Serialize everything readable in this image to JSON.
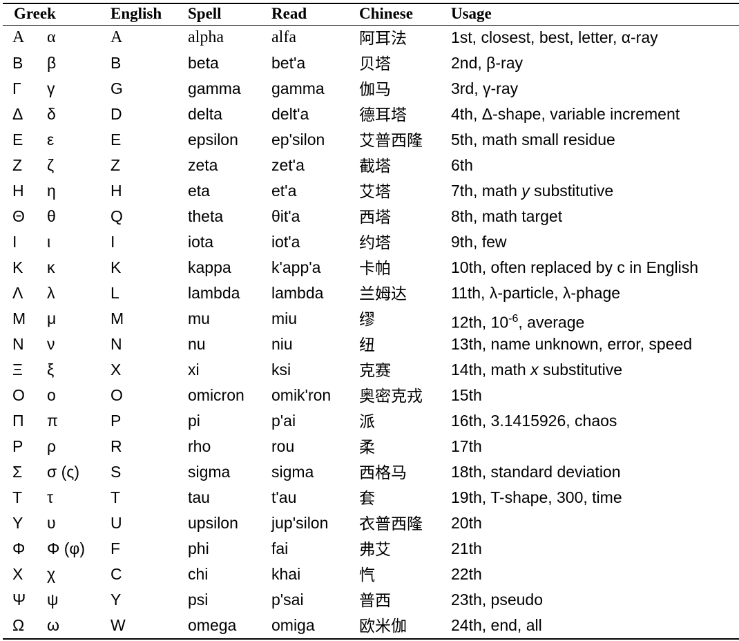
{
  "header": {
    "greek": "Greek",
    "english": "English",
    "spell": "Spell",
    "read": "Read",
    "chinese": "Chinese",
    "usage": "Usage"
  },
  "rows": [
    {
      "upper": "Α",
      "lower": "α",
      "english": "A",
      "spell": "alpha",
      "read": "alfa",
      "chinese": "阿耳法",
      "usage": "1st, closest, best, letter, α-ray"
    },
    {
      "upper": "Β",
      "lower": "β",
      "english": "B",
      "spell": "beta",
      "read": "bet'a",
      "chinese": "贝塔",
      "usage": "2nd, β-ray"
    },
    {
      "upper": "Γ",
      "lower": "γ",
      "english": "G",
      "spell": "gamma",
      "read": "gamma",
      "chinese": "伽马",
      "usage": "3rd, γ-ray"
    },
    {
      "upper": "Δ",
      "lower": "δ",
      "english": "D",
      "spell": "delta",
      "read": "delt'a",
      "chinese": "德耳塔",
      "usage": "4th, Δ-shape, variable increment"
    },
    {
      "upper": "Ε",
      "lower": "ε",
      "english": "E",
      "spell": "epsilon",
      "read": "ep'silon",
      "chinese": "艾普西隆",
      "usage": "5th, math small residue"
    },
    {
      "upper": "Ζ",
      "lower": "ζ",
      "english": "Z",
      "spell": "zeta",
      "read": "zet'a",
      "chinese": "截塔",
      "usage": "6th"
    },
    {
      "upper": "Η",
      "lower": "η",
      "english": "H",
      "spell": "eta",
      "read": "et'a",
      "chinese": "艾塔",
      "usage_pre": "7th, math ",
      "usage_em": "y",
      "usage_post": " substitutive"
    },
    {
      "upper": "Θ",
      "lower": "θ",
      "english": "Q",
      "spell": "theta",
      "read": "θit'a",
      "chinese": "西塔",
      "usage": "8th, math target"
    },
    {
      "upper": "Ι",
      "lower": "ι",
      "english": "I",
      "spell": "iota",
      "read": "iot'a",
      "chinese": "约塔",
      "usage": "9th, few"
    },
    {
      "upper": "Κ",
      "lower": "κ",
      "english": "K",
      "spell": "kappa",
      "read": "k'app'a",
      "chinese": "卡帕",
      "usage": "10th, often replaced by c in English"
    },
    {
      "upper": "Λ",
      "lower": "λ",
      "english": "L",
      "spell": "lambda",
      "read": "lambda",
      "chinese": "兰姆达",
      "usage": "11th, λ-particle, λ-phage"
    },
    {
      "upper": "Μ",
      "lower": "μ",
      "english": "M",
      "spell": "mu",
      "read": "miu",
      "chinese": "缪",
      "usage_pre": "12th, 10",
      "usage_sup": "-6",
      "usage_post": ", average"
    },
    {
      "upper": "Ν",
      "lower": "ν",
      "english": "N",
      "spell": "nu",
      "read": "niu",
      "chinese": "纽",
      "usage": "13th, name unknown, error, speed"
    },
    {
      "upper": "Ξ",
      "lower": "ξ",
      "english": "X",
      "spell": "xi",
      "read": "ksi",
      "chinese": "克赛",
      "usage_pre": "14th, math ",
      "usage_em": "x",
      "usage_post": " substitutive"
    },
    {
      "upper": "Ο",
      "lower": "ο",
      "english": "O",
      "spell": "omicron",
      "read": "omik'ron",
      "chinese": "奥密克戎",
      "usage": "15th"
    },
    {
      "upper": "Π",
      "lower": "π",
      "english": "P",
      "spell": "pi",
      "read": "p'ai",
      "chinese": "派",
      "usage": "16th, 3.1415926, chaos"
    },
    {
      "upper": "Ρ",
      "lower": "ρ",
      "english": "R",
      "spell": "rho",
      "read": "rou",
      "chinese": "柔",
      "usage": "17th"
    },
    {
      "upper": "Σ",
      "lower": "σ (ς)",
      "english": "S",
      "spell": "sigma",
      "read": "sigma",
      "chinese": "西格马",
      "usage": "18th, standard deviation"
    },
    {
      "upper": "Τ",
      "lower": "τ",
      "english": "T",
      "spell": "tau",
      "read": "t'au",
      "chinese": "套",
      "usage": "19th, T-shape, 300, time"
    },
    {
      "upper": "Υ",
      "lower": "υ",
      "english": "U",
      "spell": "upsilon",
      "read": "jup'silon",
      "chinese": "衣普西隆",
      "usage": "20th"
    },
    {
      "upper": "Φ",
      "lower": "Φ (φ)",
      "english": "F",
      "spell": "phi",
      "read": "fai",
      "chinese": "弗艾",
      "usage": "21th"
    },
    {
      "upper": "Χ",
      "lower": "χ",
      "english": "C",
      "spell": "chi",
      "read": "khai",
      "chinese": "忾",
      "usage": "22th"
    },
    {
      "upper": "Ψ",
      "lower": "ψ",
      "english": "Y",
      "spell": "psi",
      "read": "p'sai",
      "chinese": "普西",
      "usage": "23th, pseudo"
    },
    {
      "upper": "Ω",
      "lower": "ω",
      "english": "W",
      "spell": "omega",
      "read": "omiga",
      "chinese": "欧米伽",
      "usage": "24th, end, all"
    }
  ]
}
